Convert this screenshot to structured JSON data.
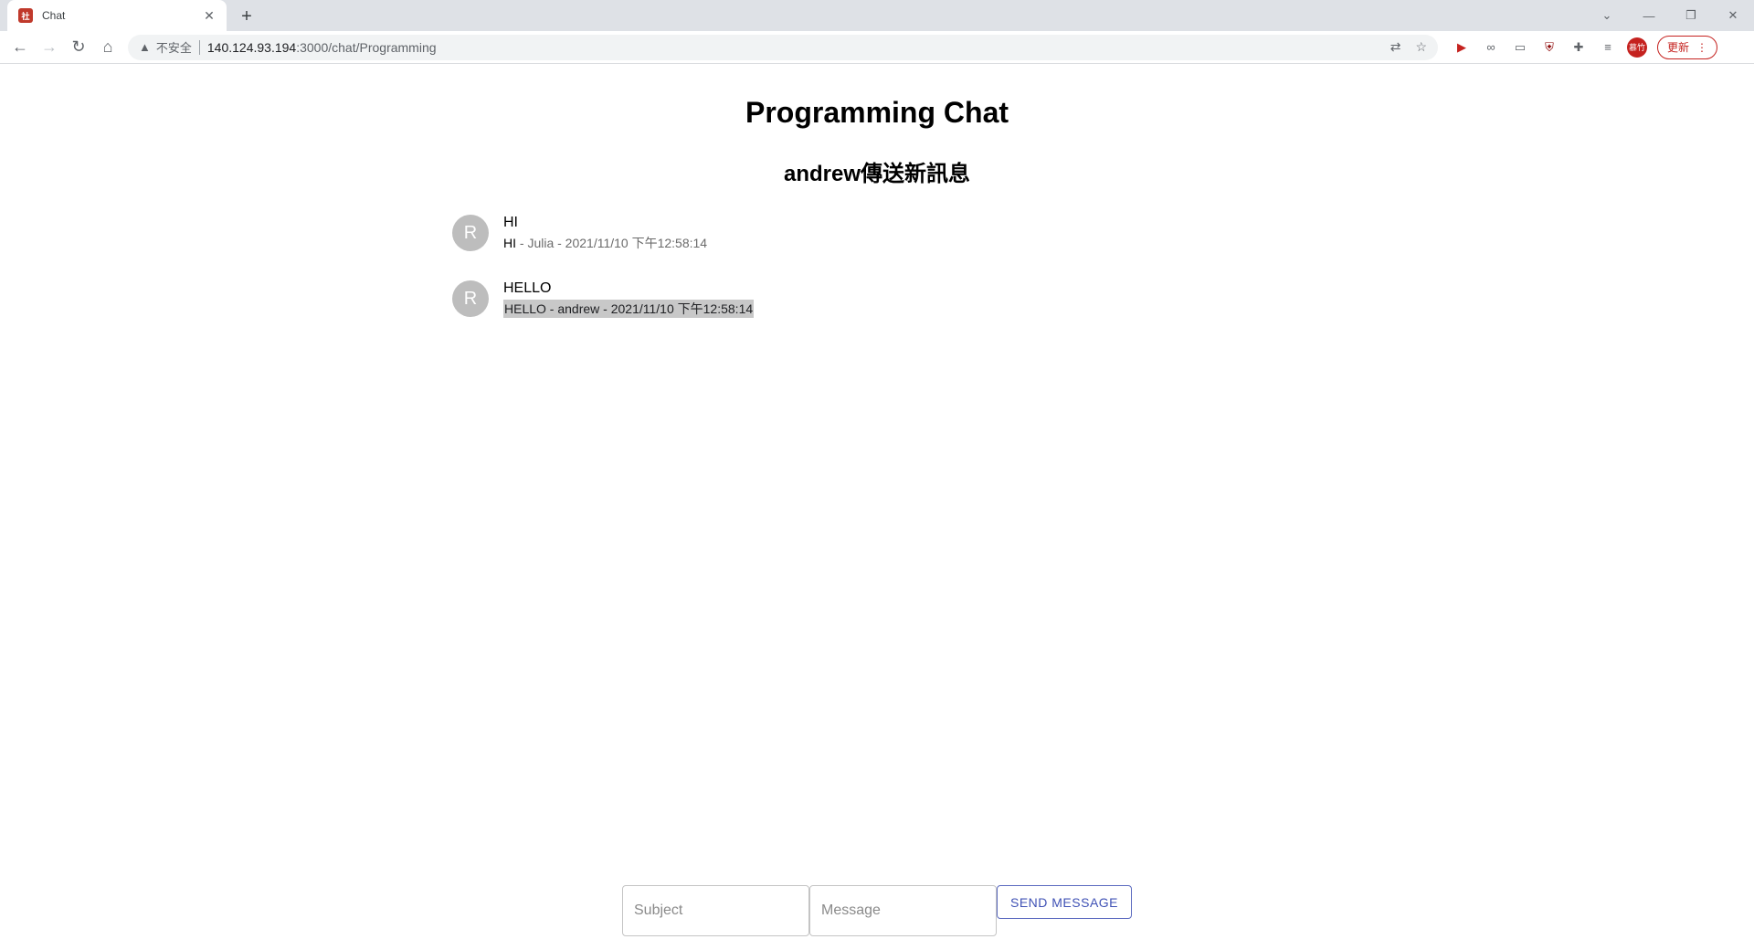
{
  "browser": {
    "tab_title": "Chat",
    "tab_favicon_text": "社",
    "url_warning": "不安全",
    "url_host": "140.124.93.194",
    "url_path": ":3000/chat/Programming",
    "update_label": "更新",
    "profile_text": "慕竹"
  },
  "page": {
    "title": "Programming Chat",
    "subtitle": "andrew傳送新訊息"
  },
  "messages": [
    {
      "avatar": "R",
      "text": "HI",
      "subject": "HI",
      "meta": " - Julia - 2021/11/10 下午12:58:14",
      "selected": false
    },
    {
      "avatar": "R",
      "text": "HELLO",
      "subject": "HELLO",
      "meta": " - andrew - 2021/11/10 下午12:58:14",
      "selected": true
    }
  ],
  "composer": {
    "subject_placeholder": "Subject",
    "message_placeholder": "Message",
    "send_label": "SEND MESSAGE"
  },
  "colors": {
    "accent": "#3f51b5",
    "avatar_bg": "#bdbdbd",
    "selection_bg": "#c8c8c8"
  }
}
